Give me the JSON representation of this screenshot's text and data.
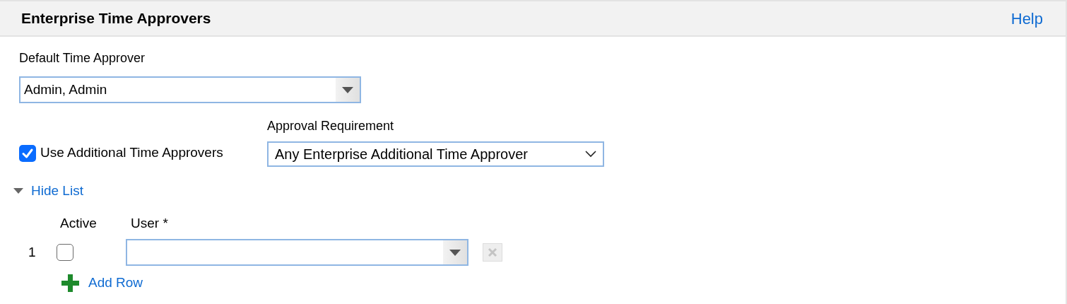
{
  "header": {
    "title": "Enterprise Time Approvers",
    "help_link": "Help"
  },
  "default_approver": {
    "label": "Default Time Approver",
    "value": "Admin, Admin"
  },
  "additional": {
    "label": "Use Additional Time Approvers",
    "checked": true
  },
  "approval_requirement": {
    "label": "Approval Requirement",
    "value": "Any Enterprise Additional Time Approver"
  },
  "list_toggle": {
    "label": "Hide List",
    "expanded": true
  },
  "table": {
    "columns": [
      "Active",
      "User *"
    ],
    "rows": [
      {
        "number": "1",
        "active": false,
        "user": ""
      }
    ]
  },
  "add_row": "Add Row"
}
